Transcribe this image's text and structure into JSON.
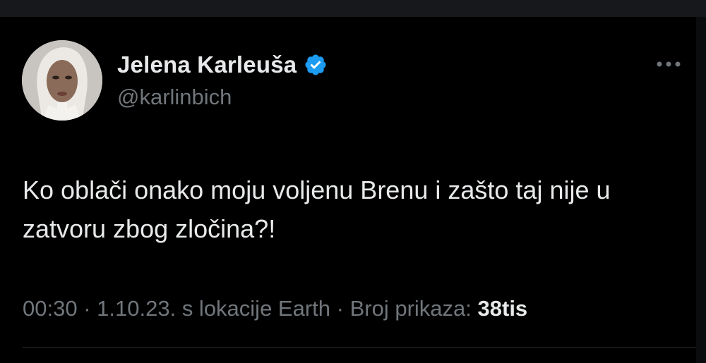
{
  "author": {
    "display_name": "Jelena Karleuša",
    "handle": "@karlinbich",
    "verified": true,
    "verified_icon": "verified-badge-icon",
    "avatar_icon": "profile-avatar"
  },
  "tweet": {
    "text": "Ko oblači onako moju voljenu Brenu i zašto taj nije u zatvoru zbog zločina?!"
  },
  "meta": {
    "time": "00:30",
    "date": "1.10.23.",
    "location": "s lokacije Earth",
    "views_label": "Broj prikaza:",
    "views_count": "38tis",
    "separator": " · "
  },
  "colors": {
    "background": "#000000",
    "text_primary": "#e7e9ea",
    "text_secondary": "#71767b",
    "verified_blue": "#1d9bf0",
    "divider": "#2f3336"
  },
  "icons": {
    "more": "more-horizontal-icon"
  }
}
